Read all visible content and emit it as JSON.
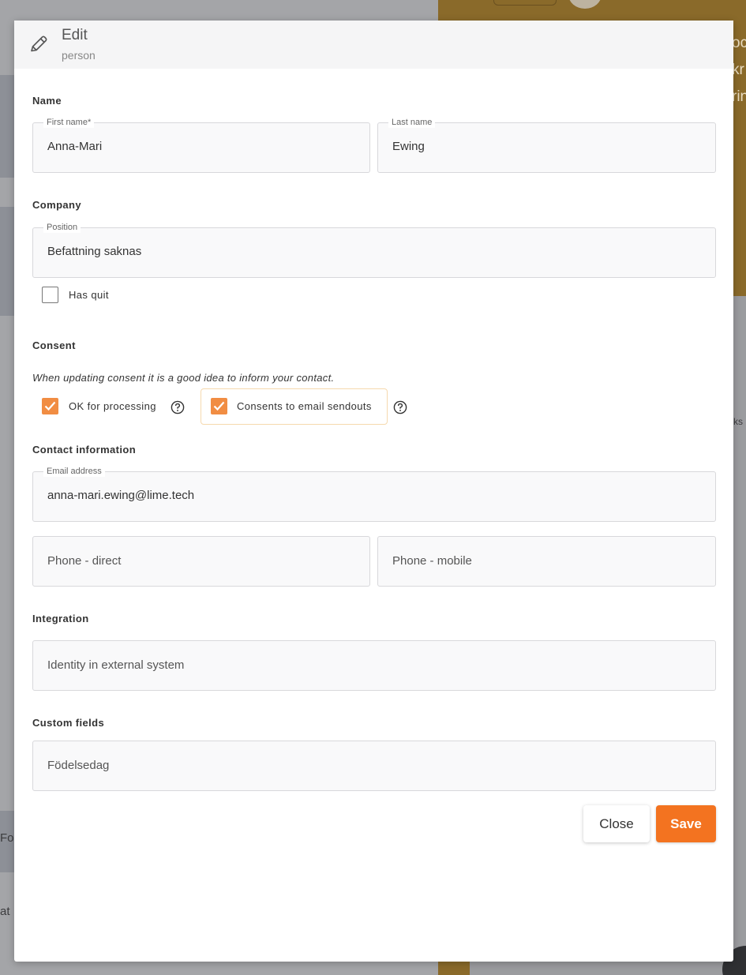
{
  "background": {
    "right_texts": [
      "oc",
      "kr",
      "rin"
    ],
    "right_mid_text": "ks",
    "left_texts": [
      "Fol",
      "at"
    ]
  },
  "modal": {
    "title": "Edit",
    "subtitle": "person",
    "icon": "pencil-icon"
  },
  "sections": {
    "name": "Name",
    "company": "Company",
    "consent": "Consent",
    "contact": "Contact information",
    "integration": "Integration",
    "custom": "Custom fields"
  },
  "fields": {
    "first_name": {
      "label": "First name*",
      "value": "Anna-Mari"
    },
    "last_name": {
      "label": "Last name",
      "value": "Ewing"
    },
    "position": {
      "label": "Position",
      "value": "Befattning saknas"
    },
    "email": {
      "label": "Email address",
      "value": "anna-mari.ewing@lime.tech"
    },
    "phone_direct": {
      "placeholder": "Phone - direct"
    },
    "phone_mobile": {
      "placeholder": "Phone - mobile"
    },
    "external_identity": {
      "placeholder": "Identity in external system"
    },
    "birthday": {
      "placeholder": "Födelsedag"
    }
  },
  "checkboxes": {
    "has_quit": {
      "label": "Has quit",
      "checked": false
    },
    "ok_processing": {
      "label": "OK for processing",
      "checked": true
    },
    "email_sendouts": {
      "label": "Consents to email sendouts",
      "checked": true
    }
  },
  "consent_note": "When updating consent it is a good idea to inform your contact.",
  "buttons": {
    "close": "Close",
    "save": "Save"
  },
  "colors": {
    "accent": "#f37320",
    "checkbox": "#f18d43"
  }
}
